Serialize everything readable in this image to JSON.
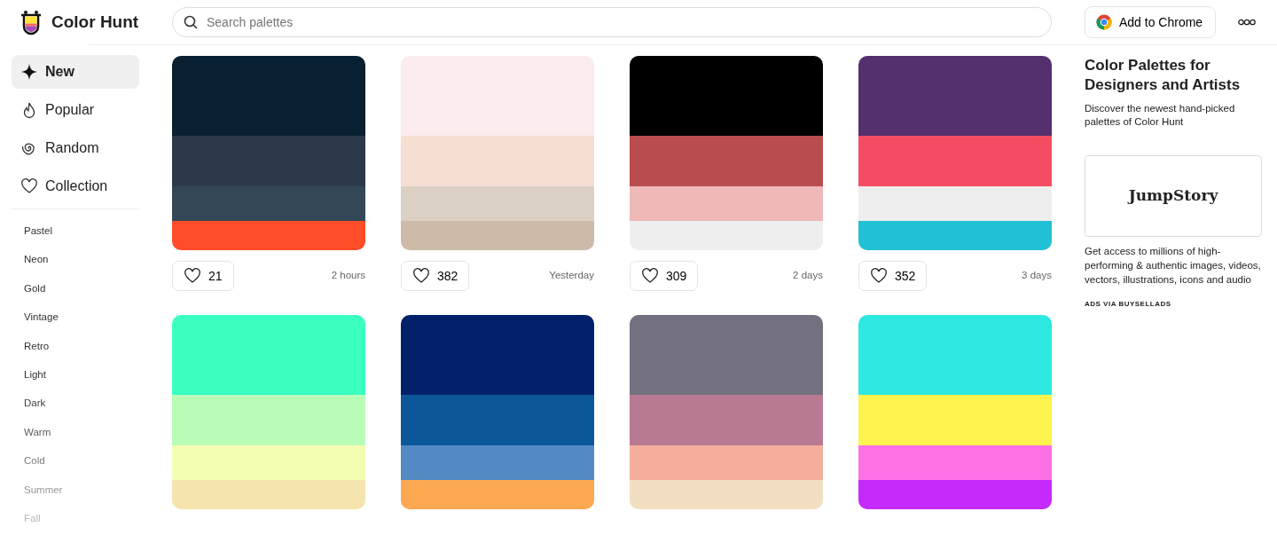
{
  "header": {
    "brand": "Color Hunt",
    "search": {
      "placeholder": "Search palettes"
    },
    "chrome_button": "Add to Chrome"
  },
  "sidebar": {
    "items": [
      {
        "label": "New",
        "selected": true
      },
      {
        "label": "Popular",
        "selected": false
      },
      {
        "label": "Random",
        "selected": false
      },
      {
        "label": "Collection",
        "selected": false
      }
    ],
    "tags": [
      "Pastel",
      "Neon",
      "Gold",
      "Vintage",
      "Retro",
      "Light",
      "Dark",
      "Warm",
      "Cold",
      "Summer",
      "Fall"
    ]
  },
  "palettes": [
    {
      "swatches": [
        {
          "color": "#082032"
        },
        {
          "color": "#2c394b"
        },
        {
          "color": "#334756"
        },
        {
          "color": "#ff4c29"
        }
      ],
      "likes": "21",
      "time": "2 hours"
    },
    {
      "swatches": [
        {
          "color": "#fbeded"
        },
        {
          "color": "#f4dfd2"
        },
        {
          "color": "#dbd0c4"
        },
        {
          "color": "#cdbba8"
        }
      ],
      "likes": "382",
      "time": "Yesterday"
    },
    {
      "swatches": [
        {
          "color": "#000000"
        },
        {
          "color": "#b94d4e"
        },
        {
          "color": "#efb8b9"
        },
        {
          "color": "#eeeeee"
        }
      ],
      "likes": "309",
      "time": "2 days"
    },
    {
      "swatches": [
        {
          "color": "#55306f"
        },
        {
          "color": "#f44d63"
        },
        {
          "color": "#eeeeee"
        },
        {
          "color": "#22c0d5"
        }
      ],
      "likes": "352",
      "time": "3 days"
    },
    {
      "swatches": [
        {
          "color": "#3bffc0"
        },
        {
          "color": "#bafdb9"
        },
        {
          "color": "#f5fdb3"
        },
        {
          "color": "#f5e4ae"
        }
      ]
    },
    {
      "swatches": [
        {
          "color": "#03216b"
        },
        {
          "color": "#0b5799"
        },
        {
          "color": "#538ac4"
        },
        {
          "color": "#fca952"
        }
      ]
    },
    {
      "swatches": [
        {
          "color": "#73707f"
        },
        {
          "color": "#b87a93"
        },
        {
          "color": "#f5ad9c"
        },
        {
          "color": "#f2dfc2"
        }
      ]
    },
    {
      "swatches": [
        {
          "color": "#2ee9df"
        },
        {
          "color": "#fff34f"
        },
        {
          "color": "#fd70e6"
        },
        {
          "color": "#c42bfb"
        }
      ]
    }
  ],
  "panel": {
    "title": "Color Palettes for Designers and Artists",
    "description": "Discover the newest hand-picked palettes of Color Hunt",
    "ad": {
      "logo": "JumpStory",
      "text": "Get access to millions of high-performing & authentic images, videos, vectors, illustrations, icons and audio",
      "via": "ADS VIA BUYSELLADS"
    }
  }
}
